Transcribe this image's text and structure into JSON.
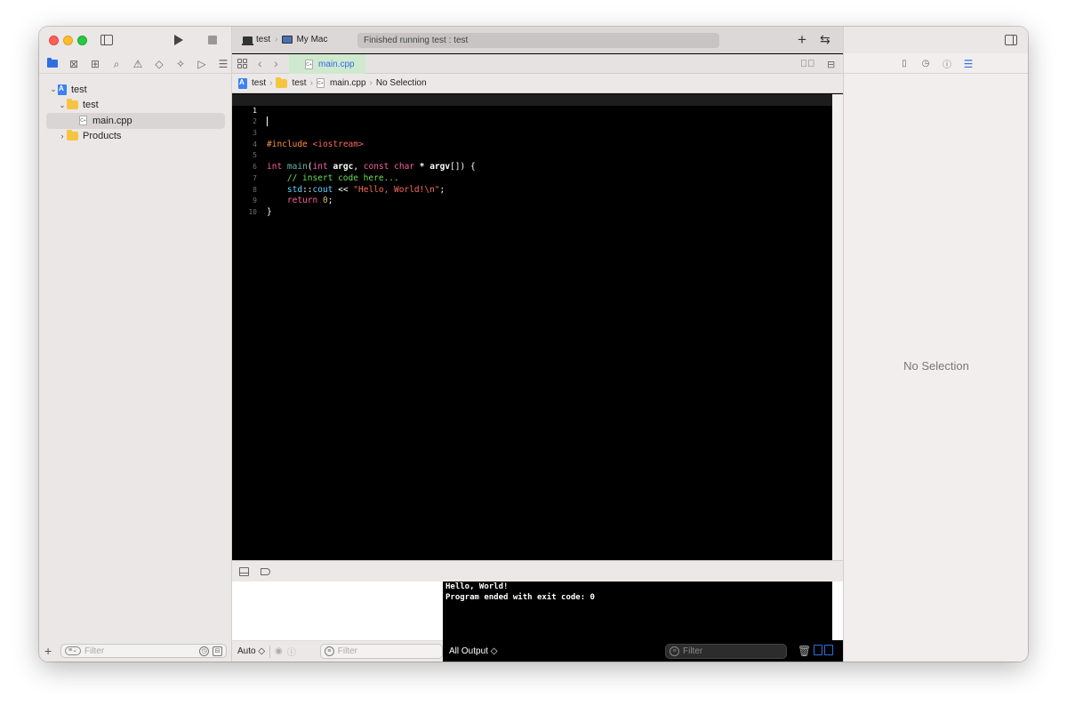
{
  "navigator": {
    "tree": [
      {
        "label": "test",
        "kind": "project",
        "expanded": true
      },
      {
        "label": "test",
        "kind": "folder",
        "expanded": true
      },
      {
        "label": "main.cpp",
        "kind": "file",
        "selected": true
      },
      {
        "label": "Products",
        "kind": "folder",
        "expanded": false
      }
    ],
    "filter_placeholder": "Filter"
  },
  "toolbar": {
    "scheme": "test",
    "destination": "My Mac",
    "status": "Finished running test : test"
  },
  "editor": {
    "tab_label": "main.cpp",
    "breadcrumb": {
      "project": "test",
      "folder": "test",
      "file": "main.cpp",
      "symbol": "No Selection"
    },
    "line_numbers": [
      "1",
      "2",
      "3",
      "4",
      "5",
      "6",
      "7",
      "8",
      "9",
      "10"
    ]
  },
  "debug": {
    "console_lines": [
      "Hello, World!",
      "Program ended with exit code: 0"
    ],
    "auto_label": "Auto ◇",
    "filter_placeholder": "Filter",
    "output_label": "All Output ◇",
    "console_filter_placeholder": "Filter"
  },
  "inspector": {
    "no_selection": "No Selection"
  },
  "colors": {
    "accent": "#2f6fe0",
    "editor_background": "#000000",
    "tab_highlight": "#cfe9cf"
  }
}
